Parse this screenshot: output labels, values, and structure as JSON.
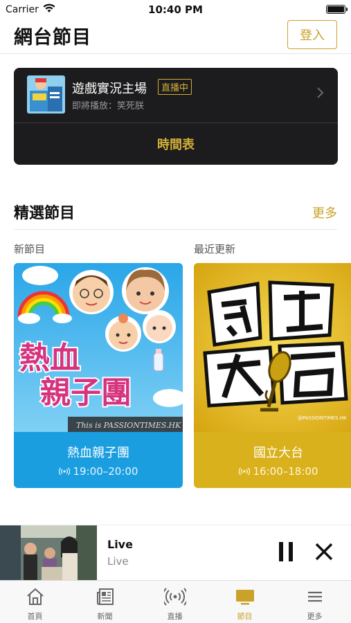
{
  "status_bar": {
    "carrier": "Carrier",
    "time": "10:40 PM"
  },
  "header": {
    "title": "網台節目",
    "login_label": "登入"
  },
  "live_card": {
    "show_name": "遊戲實況主場",
    "badge": "直播中",
    "next_up": "即將播放：笑死朕",
    "schedule_label": "時間表"
  },
  "featured": {
    "title": "精選節目",
    "more_label": "更多",
    "columns": [
      {
        "label": "新節目",
        "name": "熱血親子團",
        "time": "19:00–20:00",
        "art_title": "熱血親子團",
        "watermark": "This is PASSIONTIMES.HK",
        "color": "#1a9ee0"
      },
      {
        "label": "最近更新",
        "name": "國立大台",
        "time": "16:00–18:00",
        "art_title": "國立大台",
        "watermark": "@PASSIONTIMES.HK",
        "color": "#d9b11c"
      }
    ]
  },
  "player": {
    "title": "Live",
    "subtitle": "Live"
  },
  "tabs": [
    {
      "label": "首頁",
      "icon": "home-icon"
    },
    {
      "label": "新聞",
      "icon": "newspaper-icon"
    },
    {
      "label": "直播",
      "icon": "broadcast-icon"
    },
    {
      "label": "節目",
      "icon": "tv-icon",
      "active": true
    },
    {
      "label": "更多",
      "icon": "menu-icon"
    }
  ],
  "colors": {
    "accent": "#c9a227",
    "card_dark": "#1c1c1e"
  }
}
